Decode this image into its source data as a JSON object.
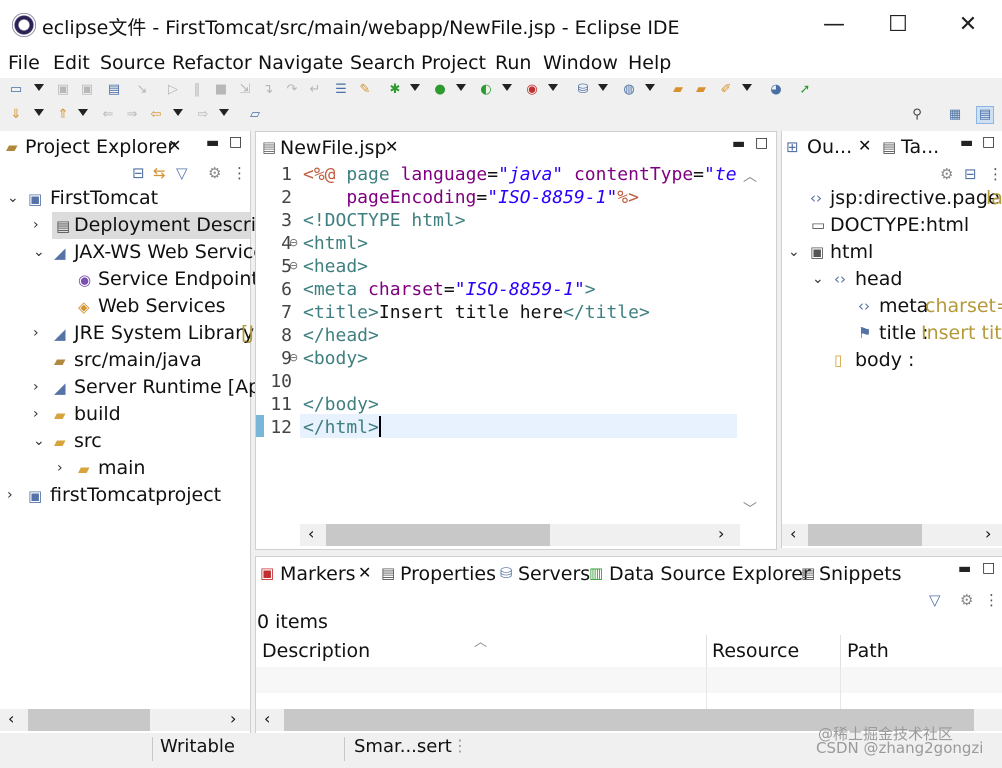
{
  "window": {
    "title": "eclipse文件 - FirstTomcat/src/main/webapp/NewFile.jsp - Eclipse IDE",
    "min": "—",
    "max": "☐",
    "close": "✕"
  },
  "menu": [
    "File",
    "Edit",
    "Source",
    "Refactor",
    "Navigate",
    "Search",
    "Project",
    "Run",
    "Window",
    "Help"
  ],
  "project_explorer": {
    "tab": "Project Explorer",
    "items": [
      {
        "label": "FirstTomcat",
        "icon": "project-icon",
        "arrow": "⌄"
      },
      {
        "label": "Deployment Descrip",
        "icon": "deployment-descriptor-icon",
        "arrow": "›"
      },
      {
        "label": "JAX-WS Web Service",
        "icon": "web-service-icon",
        "arrow": "⌄"
      },
      {
        "label": "Service Endpoint I",
        "icon": "service-endpoint-icon",
        "arrow": ""
      },
      {
        "label": "Web Services",
        "icon": "web-services-icon",
        "arrow": ""
      },
      {
        "label": "JRE System Library",
        "suffix": "[J",
        "icon": "library-icon",
        "arrow": "›"
      },
      {
        "label": "src/main/java",
        "icon": "source-folder-icon",
        "arrow": ""
      },
      {
        "label": "Server Runtime [Apa",
        "icon": "library-icon",
        "arrow": "›"
      },
      {
        "label": "build",
        "icon": "folder-icon",
        "arrow": "›"
      },
      {
        "label": "src",
        "icon": "folder-icon",
        "arrow": "⌄"
      },
      {
        "label": "main",
        "icon": "folder-icon",
        "arrow": "›"
      },
      {
        "label": "firstTomcatproject",
        "icon": "project-icon",
        "arrow": "›"
      }
    ]
  },
  "editor": {
    "tab": "NewFile.jsp",
    "line_numbers": [
      "1",
      "2",
      "3",
      "4",
      "5",
      "6",
      "7",
      "8",
      "9",
      "10",
      "11",
      "12"
    ],
    "fold_markers": {
      "4": "⊖",
      "5": "⊖",
      "9": "⊖"
    }
  },
  "code": {
    "l1a": "<%@",
    "l1b": " page ",
    "l1c": "language",
    "l1d": "=",
    "l1e": "\"java\"",
    "l1f": " contentType",
    "l1g": "=",
    "l1h": "\"te",
    "l2a": "    pageEncoding",
    "l2b": "=",
    "l2c": "\"ISO-8859-1\"",
    "l2d": "%>",
    "l3": "<!DOCTYPE html>",
    "l4": "<html>",
    "l5": "<head>",
    "l6a": "<meta ",
    "l6b": "charset",
    "l6c": "=",
    "l6d": "\"ISO-8859-1\"",
    "l6e": ">",
    "l7a": "<title>",
    "l7b": "Insert title here",
    "l7c": "</title>",
    "l8": "</head>",
    "l9": "<body>",
    "l11": "</body>",
    "l12": "</html>"
  },
  "outline": {
    "tab1": "Ou...",
    "tab2": "Ta...",
    "items": [
      {
        "label": "jsp:directive.page",
        "suffix": " la"
      },
      {
        "label": "DOCTYPE:html",
        "suffix": ""
      },
      {
        "label": "html",
        "suffix": ""
      },
      {
        "label": "head",
        "suffix": ""
      },
      {
        "label": "meta",
        "suffix": " charset="
      },
      {
        "label": "title :",
        "suffix": " Insert titl"
      },
      {
        "label": "body :",
        "suffix": ""
      }
    ]
  },
  "bottom": {
    "tabs": [
      "Markers",
      "Properties",
      "Servers",
      "Data Source Explorer",
      "Snippets"
    ],
    "count": "0 items",
    "columns": [
      "Description",
      "Resource",
      "Path"
    ]
  },
  "status": {
    "writable": "Writable",
    "insert_mode": "Smar...sert"
  },
  "watermark": "CSDN @zhang2gongzi",
  "watermark2": "@稀土掘金技术社区"
}
